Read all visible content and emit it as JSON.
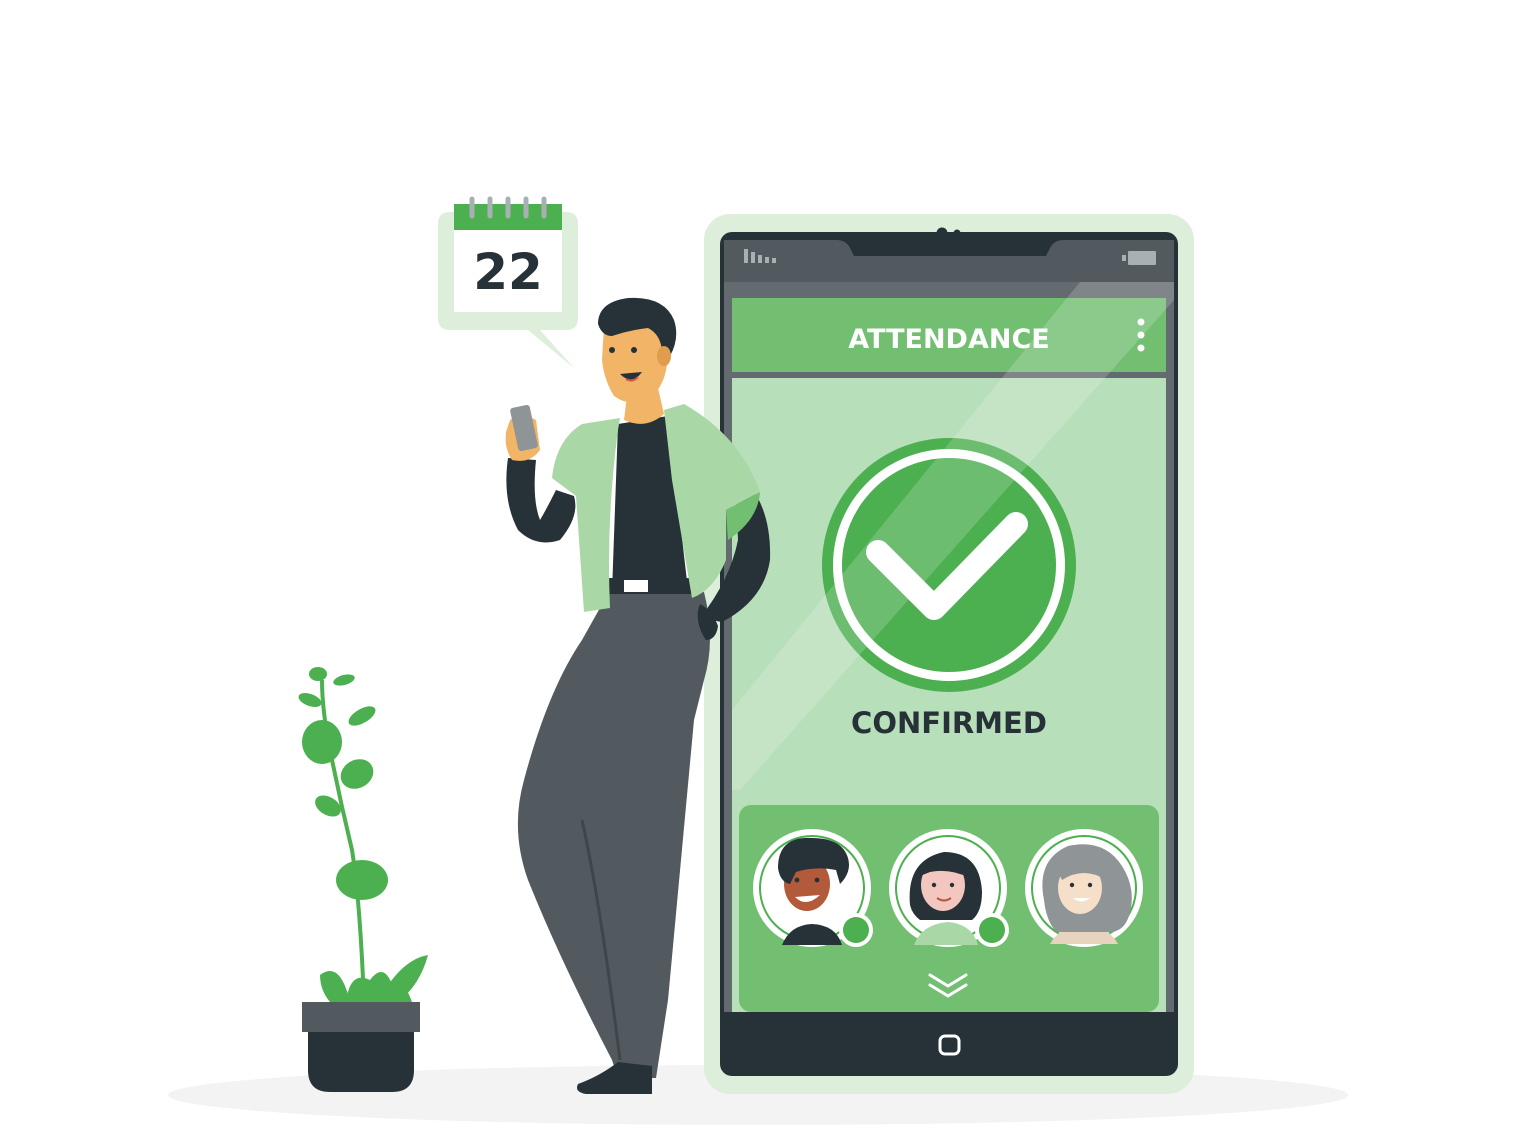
{
  "calendar": {
    "day": "22"
  },
  "app": {
    "title": "ATTENDANCE",
    "menu_icon": "more-vertical-icon",
    "status": "CONFIRMED",
    "status_icon": "check-circle-icon",
    "expand_icon": "chevron-double-down-icon",
    "home_icon": "home-button-icon"
  },
  "attendees": [
    {
      "name_icon": "avatar-man-icon",
      "confirmed": true
    },
    {
      "name_icon": "avatar-woman-icon",
      "confirmed": true
    },
    {
      "name_icon": "avatar-elder-woman-icon",
      "confirmed": false
    }
  ],
  "colors": {
    "accent": "#4caf50",
    "accent_mid": "#73bf72",
    "accent_light": "#b7dfb9",
    "frame_light": "#ddefdb",
    "dark": "#263238",
    "grey": "#525a60"
  }
}
